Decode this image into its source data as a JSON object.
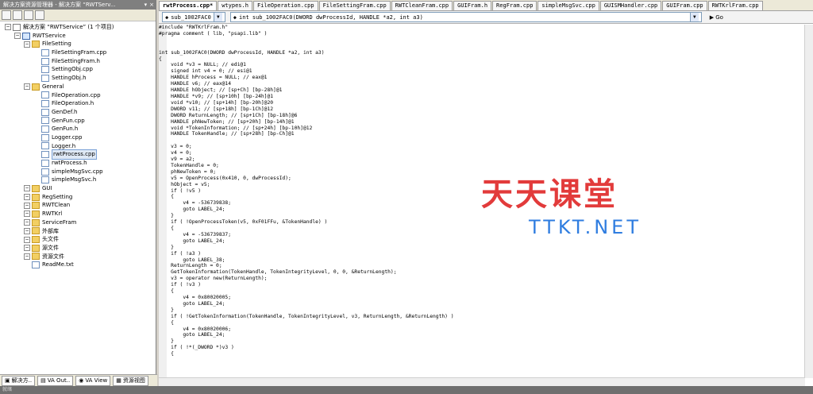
{
  "left_panel": {
    "title": "解决方案资源管理器 - 解决方案 “RWTServ...",
    "solution_label": "解决方案 “RWTService” (1 个项目)",
    "tree": [
      {
        "indent": 0,
        "type": "sol",
        "label": "解决方案 “RWTService” (1 个项目)"
      },
      {
        "indent": 1,
        "type": "proj",
        "label": "RWTService"
      },
      {
        "indent": 2,
        "type": "folder",
        "label": "FileSetting"
      },
      {
        "indent": 3,
        "type": "file",
        "label": "FileSettingFram.cpp"
      },
      {
        "indent": 3,
        "type": "file",
        "label": "FileSettingFram.h"
      },
      {
        "indent": 3,
        "type": "file",
        "label": "SettingObj.cpp"
      },
      {
        "indent": 3,
        "type": "file",
        "label": "SettingObj.h"
      },
      {
        "indent": 2,
        "type": "folder",
        "label": "General"
      },
      {
        "indent": 3,
        "type": "file",
        "label": "FileOperation.cpp"
      },
      {
        "indent": 3,
        "type": "file",
        "label": "FileOperation.h"
      },
      {
        "indent": 3,
        "type": "file",
        "label": "GenDef.h"
      },
      {
        "indent": 3,
        "type": "file",
        "label": "GenFun.cpp"
      },
      {
        "indent": 3,
        "type": "file",
        "label": "GenFun.h"
      },
      {
        "indent": 3,
        "type": "file",
        "label": "Logger.cpp"
      },
      {
        "indent": 3,
        "type": "file",
        "label": "Logger.h"
      },
      {
        "indent": 3,
        "type": "file",
        "label": "rwtProcess.cpp",
        "selected": true
      },
      {
        "indent": 3,
        "type": "file",
        "label": "rwtProcess.h"
      },
      {
        "indent": 3,
        "type": "file",
        "label": "simpleMsgSvc.cpp"
      },
      {
        "indent": 3,
        "type": "file",
        "label": "simpleMsgSvc.h"
      },
      {
        "indent": 2,
        "type": "folder",
        "label": "GUI"
      },
      {
        "indent": 2,
        "type": "folder",
        "label": "RegSetting"
      },
      {
        "indent": 2,
        "type": "folder",
        "label": "RWTClean"
      },
      {
        "indent": 2,
        "type": "folder",
        "label": "RWTKrl"
      },
      {
        "indent": 2,
        "type": "folder",
        "label": "ServiceFram"
      },
      {
        "indent": 2,
        "type": "folder",
        "label": "外部库"
      },
      {
        "indent": 2,
        "type": "folder",
        "label": "头文件"
      },
      {
        "indent": 2,
        "type": "folder",
        "label": "源文件"
      },
      {
        "indent": 2,
        "type": "folder",
        "label": "资源文件"
      },
      {
        "indent": 2,
        "type": "file",
        "label": "ReadMe.txt"
      }
    ],
    "bottom_tabs": [
      "解决方..",
      "VA Out..",
      "VA View",
      "资源视图"
    ]
  },
  "editor": {
    "tabs": [
      {
        "label": "rwtProcess.cpp*",
        "active": true
      },
      {
        "label": "wtypes.h"
      },
      {
        "label": "FileOperation.cpp"
      },
      {
        "label": "FileSettingFram.cpp"
      },
      {
        "label": "RWTCleanFram.cpp"
      },
      {
        "label": "GUIFram.h"
      },
      {
        "label": "RegFram.cpp"
      },
      {
        "label": "simpleMsgSvc.cpp"
      },
      {
        "label": "GUISMHandler.cpp"
      },
      {
        "label": "GUIFram.cpp"
      },
      {
        "label": "RWTKrlFram.cpp"
      }
    ],
    "function_combo_left": "sub_1002FAC0",
    "function_combo_right": "int sub_1002FAC0(DWORD dwProcessId, HANDLE *a2, int a3)",
    "go_label": "Go",
    "code": "#include \"RWTKrlFram.h\"\n#pragma comment ( lib, \"psapi.lib\" )\n\n\nint sub_1002FAC0(DWORD dwProcessId, HANDLE *a2, int a3)\n{\n    void *v3 = NULL; // edi@1\n    signed int v4 = 0; // esi@1\n    HANDLE hProcess = NULL; // eax@1\n    HANDLE v6; // eax@14\n    HANDLE hObject; // [sp+Ch] [bp-28h]@1\n    HANDLE *v9; // [sp+10h] [bp-24h]@1\n    void *v10; // [sp+14h] [bp-20h]@20\n    DWORD v11; // [sp+18h] [bp-1Ch]@12\n    DWORD ReturnLength; // [sp+1Ch] [bp-18h]@6\n    HANDLE phNewToken; // [sp+20h] [bp-14h]@1\n    void *TokenInformation; // [sp+24h] [bp-10h]@12\n    HANDLE TokenHandle; // [sp+28h] [bp-Ch]@1\n\n    v3 = 0;\n    v4 = 0;\n    v9 = a2;\n    TokenHandle = 0;\n    phNewToken = 0;\n    v5 = OpenProcess(0x410, 0, dwProcessId);\n    hObject = v5;\n    if ( !v5 )\n    {\n        v4 = -536739838;\n        goto LABEL_24;\n    }\n    if ( !OpenProcessToken(v5, 0xF01FFu, &TokenHandle) )\n    {\n        v4 = -536739837;\n        goto LABEL_24;\n    }\n    if ( !a3 )\n        goto LABEL_38;\n    ReturnLength = 0;\n    GetTokenInformation(TokenHandle, TokenIntegrityLevel, 0, 0, &ReturnLength);\n    v3 = operator new(ReturnLength);\n    if ( !v3 )\n    {\n        v4 = 0x80020005;\n        goto LABEL_24;\n    }\n    if ( !GetTokenInformation(TokenHandle, TokenIntegrityLevel, v3, ReturnLength, &ReturnLength) )\n    {\n        v4 = 0x80020006;\n        goto LABEL_24;\n    }\n    if ( !*(_DWORD *)v3 )\n    {"
  },
  "watermark": {
    "title": "天天课堂",
    "subtitle": "TTKT.NET"
  },
  "status_bar": {
    "text": "就绪"
  }
}
